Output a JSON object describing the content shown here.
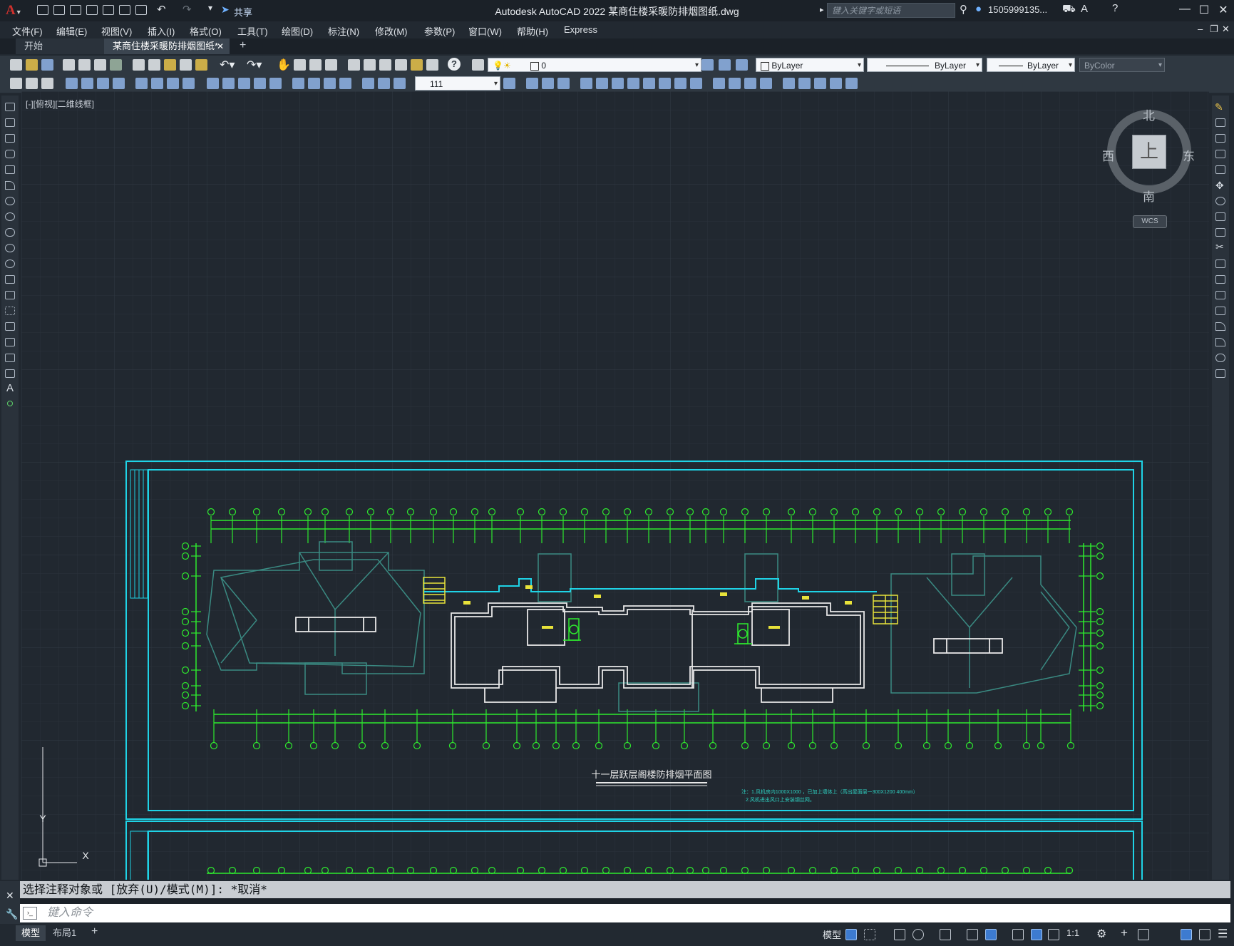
{
  "app": {
    "title": "Autodesk AutoCAD 2022    某商住楼采暖防排烟图纸.dwg",
    "share_label": "共享",
    "search_placeholder": "键入关键字或短语",
    "user": "1505999135...",
    "window_buttons": [
      "—",
      "☐",
      "✕"
    ]
  },
  "menu": [
    "文件(F)",
    "编辑(E)",
    "视图(V)",
    "插入(I)",
    "格式(O)",
    "工具(T)",
    "绘图(D)",
    "标注(N)",
    "修改(M)",
    "参数(P)",
    "窗口(W)",
    "帮助(H)",
    "Express"
  ],
  "tabs": [
    {
      "label": "开始",
      "active": false
    },
    {
      "label": "某商住楼采暖防排烟图纸*",
      "active": true
    }
  ],
  "toolbar": {
    "layer_value": "0",
    "color_value": "ByLayer",
    "linetype_value": "ByLayer",
    "lineweight_value": "ByLayer",
    "plotstyle_value": "ByColor",
    "dimstyle_value": "111"
  },
  "viewport": {
    "label": "[-][俯视][二维线框]",
    "viewcube": {
      "north": "北",
      "south": "南",
      "east": "东",
      "west": "西",
      "face": "上",
      "wcs": "WCS"
    },
    "ucs": {
      "x": "X",
      "y": "Y"
    }
  },
  "drawing": {
    "title": "十一层跃层阁楼防排烟平面图",
    "notes": [
      "注：1.风机房内1000X1000 ，已加上墙体上（高出屋面层一300X1200 400mm）",
      "2.风机进出风口上安装钢丝网。"
    ],
    "colors": {
      "frame": "#1fd3e6",
      "axis": "#2eea2e",
      "wall": "#e8e8e8",
      "roof": "#3a8a82",
      "text": "#e8e23a",
      "bubble": "#2eea2e"
    }
  },
  "command": {
    "history": "选择注释对象或 [放弃(U)/模式(M)]: *取消*",
    "placeholder": "键入命令"
  },
  "status": {
    "tabs": [
      {
        "label": "模型",
        "active": true
      },
      {
        "label": "布局1",
        "active": false
      }
    ],
    "model_label": "模型",
    "scale": "1:1"
  }
}
